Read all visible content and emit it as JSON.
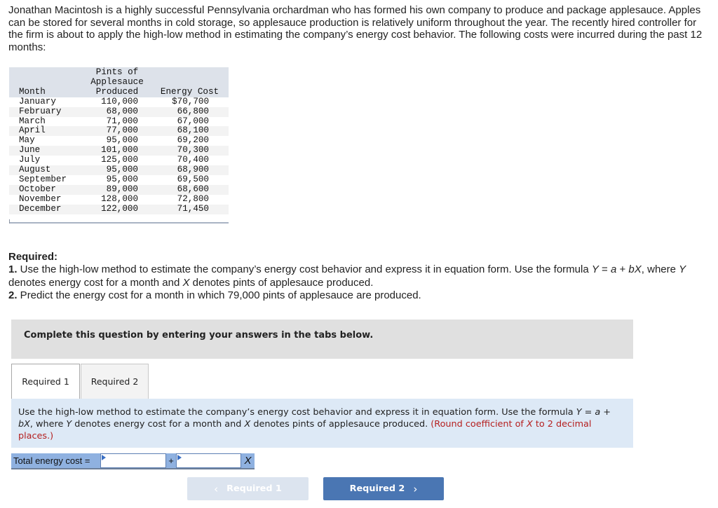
{
  "intro": "Jonathan Macintosh is a highly successful Pennsylvania orchardman who has formed his own company to produce and package applesauce. Apples can be stored for several months in cold storage, so applesauce production is relatively uniform throughout the year. The recently hired controller for the firm is about to apply the high-low method in estimating the company’s energy cost behavior. The following costs were incurred during the past 12 months:",
  "table": {
    "headers": {
      "month": "Month",
      "pints_line1": "Pints of",
      "pints_line2": "Applesauce",
      "pints_line3": "Produced",
      "cost": "Energy Cost"
    },
    "rows": [
      {
        "month": "January",
        "pints": "110,000",
        "cost": "$70,700"
      },
      {
        "month": "February",
        "pints": "68,000",
        "cost": "66,800"
      },
      {
        "month": "March",
        "pints": "71,000",
        "cost": "67,000"
      },
      {
        "month": "April",
        "pints": "77,000",
        "cost": "68,100"
      },
      {
        "month": "May",
        "pints": "95,000",
        "cost": "69,200"
      },
      {
        "month": "June",
        "pints": "101,000",
        "cost": "70,300"
      },
      {
        "month": "July",
        "pints": "125,000",
        "cost": "70,400"
      },
      {
        "month": "August",
        "pints": "95,000",
        "cost": "68,900"
      },
      {
        "month": "September",
        "pints": "95,000",
        "cost": "69,500"
      },
      {
        "month": "October",
        "pints": "89,000",
        "cost": "68,600"
      },
      {
        "month": "November",
        "pints": "128,000",
        "cost": "72,800"
      },
      {
        "month": "December",
        "pints": "122,000",
        "cost": "71,450"
      }
    ]
  },
  "required": {
    "heading": "Required:",
    "item1_num": "1.",
    "item1_text_a": " Use the high-low method to estimate the company’s energy cost behavior and express it in equation form. Use the formula ",
    "item1_formula_Y": "Y",
    "item1_formula_eq": " = ",
    "item1_formula_a": "a",
    "item1_formula_plus": " + ",
    "item1_formula_bX": "bX",
    "item1_text_b": ", where ",
    "item1_Y2": "Y",
    "item1_text_c": " denotes energy cost for a month and ",
    "item1_X": "X",
    "item1_text_d": " denotes pints of applesauce produced.",
    "item2_num": "2.",
    "item2_text": " Predict the energy cost for a month in which 79,000 pints of applesauce are produced."
  },
  "instruction_banner": "Complete this question by entering your answers in the tabs below.",
  "tabs": [
    {
      "label": "Required 1",
      "active": true
    },
    {
      "label": "Required 2",
      "active": false
    }
  ],
  "prompt": {
    "text_a": "Use the high-low method to estimate the company’s energy cost behavior and express it in equation form. Use the formula ",
    "Y": "Y",
    "text_b": " = ",
    "a": "a",
    "text_c": " + ",
    "bX": "bX",
    "text_d": ", where ",
    "Y2": "Y",
    "text_e": " denotes energy cost for a month and ",
    "X": "X",
    "text_f": " denotes pints of applesauce produced. ",
    "hint_a": "(Round coefficient of ",
    "hint_X": "X",
    "hint_b": " to 2 decimal places.)"
  },
  "answer": {
    "label": "Total energy cost =",
    "fixed_value": "",
    "plus": "+",
    "variable_value": "",
    "x_label": "X"
  },
  "nav": {
    "prev_label": "Required 1",
    "prev_icon": "chevron-left-icon",
    "next_label": "Required 2",
    "next_icon": "chevron-right-icon"
  },
  "colors": {
    "table_header_bg": "#dde2ea",
    "banner_bg": "#e0e0e0",
    "prompt_bg": "#dde9f6",
    "hint_text": "#b52020",
    "answer_row_bg": "#8fb1e0",
    "next_button_bg": "#4a76b3",
    "prev_button_bg": "#dce4ef"
  }
}
